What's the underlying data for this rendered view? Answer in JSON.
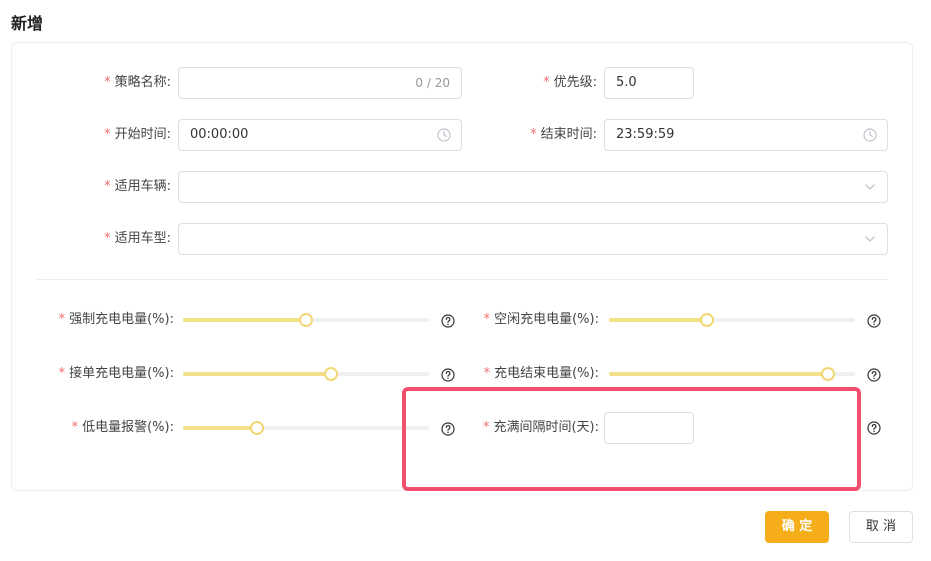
{
  "page": {
    "title": "新增"
  },
  "form": {
    "strategy_name": {
      "label": "策略名称:",
      "value": "",
      "counter": "0 / 20"
    },
    "priority": {
      "label": "优先级:",
      "value": "5.0"
    },
    "start_time": {
      "label": "开始时间:",
      "value": "00:00:00"
    },
    "end_time": {
      "label": "结束时间:",
      "value": "23:59:59"
    },
    "vehicles": {
      "label": "适用车辆:",
      "value": ""
    },
    "models": {
      "label": "适用车型:",
      "value": ""
    }
  },
  "sliders": {
    "force_charge": {
      "label": "强制充电电量(%):",
      "level": 0.5
    },
    "idle_charge": {
      "label": "空闲充电电量(%):",
      "level": 0.4
    },
    "order_charge": {
      "label": "接单充电电量(%):",
      "level": 0.6
    },
    "charge_end": {
      "label": "充电结束电量(%):",
      "level": 0.89
    },
    "low_battery": {
      "label": "低电量报警(%):",
      "level": 0.3
    }
  },
  "full_interval": {
    "label": "充满间隔时间(天):",
    "value": ""
  },
  "required_mark": "*",
  "buttons": {
    "confirm": "确 定",
    "cancel": "取 消"
  },
  "colors": {
    "accent": "#f5ae1a",
    "slider_track": "#f5e08a",
    "required": "#f56c6c",
    "highlight": "#f0506e"
  },
  "icons": {
    "time": "clock-icon",
    "select": "chevron-down-icon",
    "help": "question-circle-icon"
  }
}
